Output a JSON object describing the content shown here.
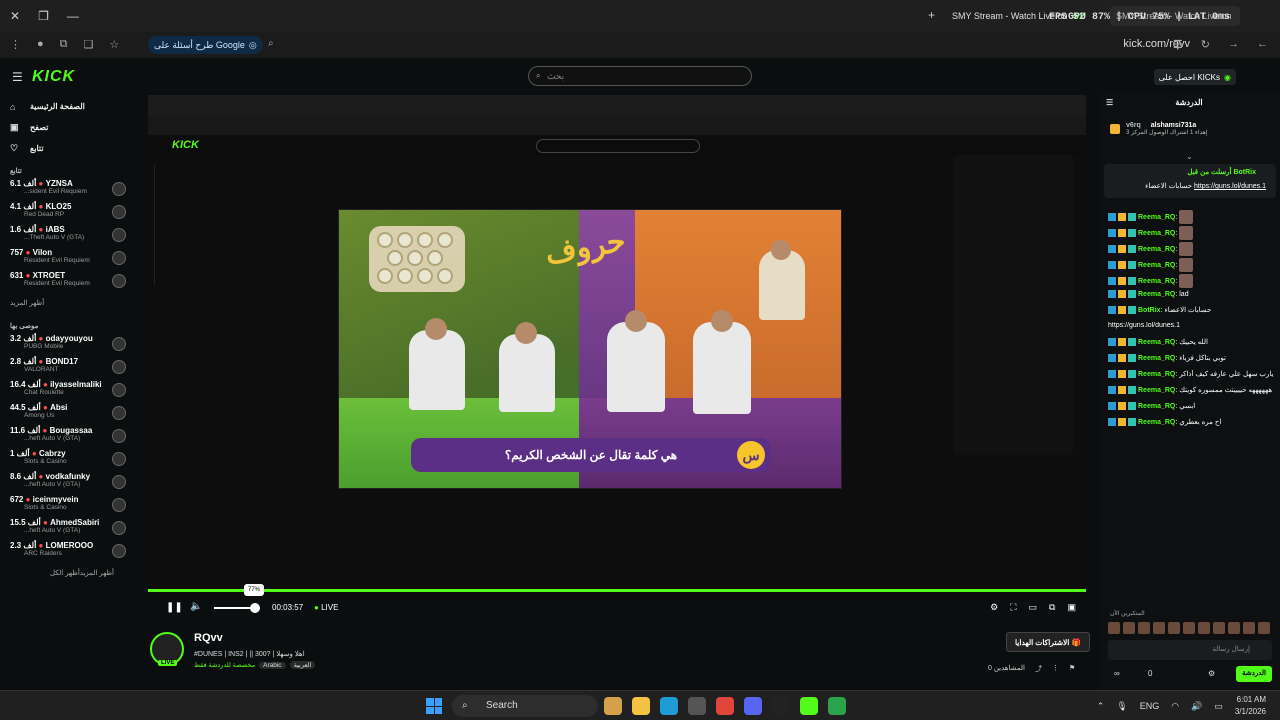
{
  "browser": {
    "tab_title": "SMY Stream - Watch Live on",
    "tab2_title": "SMY Stream - Watch Live on",
    "fps_label": "FPS",
    "fps_value": "52",
    "cpu_text": "GPU 87% | CPU 75% | LAT 0ms",
    "url": "kick.com/rqvv",
    "google_chip": "طرح أسئلة على Google"
  },
  "kick": {
    "logo": "KICK",
    "search_placeholder": "بحث",
    "kicks_button": "احصل على KICKs"
  },
  "sidebar": {
    "nav": [
      {
        "label": "الصفحة الرئيسية",
        "icon": "home-icon"
      },
      {
        "label": "تصفح",
        "icon": "browse-icon"
      },
      {
        "label": "تتابع",
        "icon": "heart-icon"
      }
    ],
    "following_label": "تتابع",
    "following": [
      {
        "viewers": "6.1 ألف",
        "name": "YZNSA",
        "game": "...sident Evil Requiem"
      },
      {
        "viewers": "4.1 ألف",
        "name": "KLO25",
        "game": "Red Dead RP"
      },
      {
        "viewers": "1.6 ألف",
        "name": "iABS",
        "game": "...Theft Auto V (GTA)"
      },
      {
        "viewers": "757",
        "name": "Vilon",
        "game": "Resident Evil Requiem"
      },
      {
        "viewers": "631",
        "name": "XTROET",
        "game": "Resident Evil Requiem"
      }
    ],
    "show_more": "أظهر المزيد",
    "recommended_label": "موصى بها",
    "recommended": [
      {
        "viewers": "3.2 ألف",
        "name": "odayyouyou",
        "game": "PUBG Mobile"
      },
      {
        "viewers": "2.8 ألف",
        "name": "BOND17",
        "game": "VALORANT"
      },
      {
        "viewers": "16.4 ألف",
        "name": "ilyasselmaliki",
        "game": "Chat Roulette"
      },
      {
        "viewers": "44.5 ألف",
        "name": "Absi",
        "game": "Among Us"
      },
      {
        "viewers": "11.6 ألف",
        "name": "Bougassaa",
        "game": "...heft Auto V (GTA)"
      },
      {
        "viewers": "1 ألف",
        "name": "Cabrzy",
        "game": "Slots & Casino"
      },
      {
        "viewers": "8.6 ألف",
        "name": "vodkafunky",
        "game": "...heft Auto V (GTA)"
      },
      {
        "viewers": "672",
        "name": "iceinmyvein",
        "game": "Slots & Casino"
      },
      {
        "viewers": "15.5 ألف",
        "name": "AhmedSabiri",
        "game": "...heft Auto V (GTA)"
      },
      {
        "viewers": "2.3 ألف",
        "name": "LOMEROOO",
        "game": "ARC Raiders"
      }
    ],
    "show_more2": "أظهر المزيد",
    "show_all": "أظهر الكل"
  },
  "video": {
    "banner": "هي كلمة تقال عن الشخص الكريم؟",
    "badge": "س",
    "show_logo": "حروف"
  },
  "player": {
    "volume_pct": "77%",
    "time": "00:03:57",
    "live": "LIVE"
  },
  "streamer": {
    "name": "RQvv",
    "title": "#DUNES | INS2 | || 300? | اهلا وسهلا",
    "category": "مخصصة للدردشة فقط",
    "tags": [
      "Arabic",
      "العربية"
    ],
    "notify_button": "الاشتراكات الهدايا",
    "viewers": "0 المشاهدين"
  },
  "chat": {
    "header": "الدردشة",
    "top_user": "alshamsi731a",
    "top_user_rank": "v6rq",
    "top_user_sub": "إهداء 1 اشتراك الوصول المركز 3",
    "pinned_user": "BotRix",
    "pinned_label": "أرسلت من قبل",
    "pinned_text": "حسابات الاعضاء",
    "pinned_link": "https://guns.lol/dunes.1",
    "messages": [
      {
        "user": "Reema_RQ",
        "text": ""
      },
      {
        "user": "Reema_RQ",
        "text": ""
      },
      {
        "user": "Reema_RQ",
        "text": ""
      },
      {
        "user": "Reema_RQ",
        "text": ""
      },
      {
        "user": "Reema_RQ",
        "text": ""
      },
      {
        "user": "Reema_RQ",
        "text": ": lad"
      },
      {
        "user": "BotRix",
        "text": ": حسابات الاعضاء"
      },
      {
        "user": "",
        "text": "https://guns.lol/dunes.1"
      },
      {
        "user": "Reema_RQ",
        "text": ": الله يحييك"
      },
      {
        "user": "Reema_RQ",
        "text": ": توبي بتاكل فزياء"
      },
      {
        "user": "Reema_RQ",
        "text": ": يارب سهل علي عارفه كيف أذاكر"
      },
      {
        "user": "Reema_RQ",
        "text": ": ههههههه حييييتث ممسوره كويتك"
      },
      {
        "user": "Reema_RQ",
        "text": ": ابسي"
      },
      {
        "user": "Reema_RQ",
        "text": ": اح مره بعطري"
      }
    ],
    "emotes_label": "المتكبرين الآن",
    "input_placeholder": "إرسال رسالة",
    "send_button": "الدردشة",
    "count": "0"
  },
  "taskbar": {
    "search": "Search",
    "lang": "ENG",
    "time": "6:01 AM",
    "date": "3/1/2026"
  }
}
